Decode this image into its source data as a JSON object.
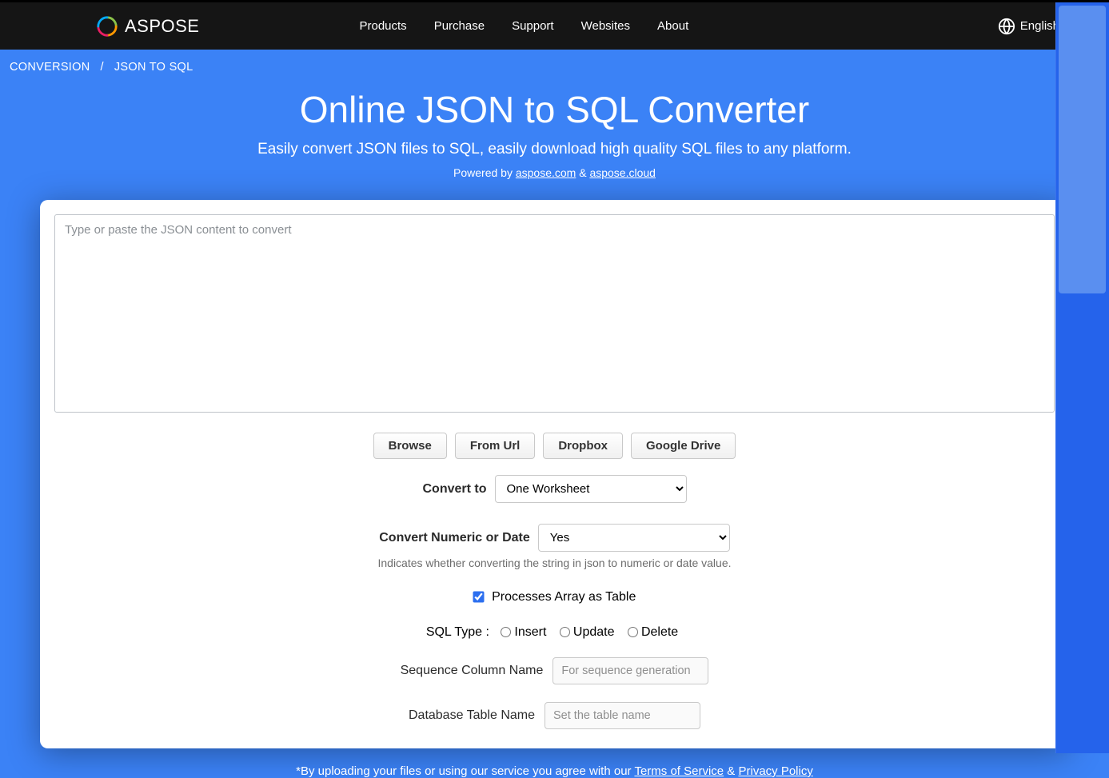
{
  "header": {
    "brand_text": "ASPOSE",
    "nav": [
      "Products",
      "Purchase",
      "Support",
      "Websites",
      "About"
    ],
    "language_label": "English"
  },
  "breadcrumb": {
    "parent": "CONVERSION",
    "sep": "/",
    "current": "JSON TO SQL"
  },
  "hero": {
    "title": "Online JSON to SQL Converter",
    "subtitle": "Easily convert JSON files to SQL, easily download high quality SQL files to any platform.",
    "powered_prefix": "Powered by ",
    "powered_link1": "aspose.com",
    "powered_amp": " & ",
    "powered_link2": "aspose.cloud"
  },
  "form": {
    "textarea_placeholder": "Type or paste the JSON content to convert",
    "buttons": {
      "browse": "Browse",
      "from_url": "From Url",
      "dropbox": "Dropbox",
      "gdrive": "Google Drive"
    },
    "convert_to_label": "Convert to",
    "convert_to_value": "One Worksheet",
    "convert_num_label": "Convert Numeric or Date",
    "convert_num_value": "Yes",
    "convert_num_hint": "Indicates whether converting the string in json to numeric or date value.",
    "process_array_label": "Processes Array as Table",
    "sql_type_label": "SQL Type : ",
    "sql_types": {
      "insert": "Insert",
      "update": "Update",
      "delete": "Delete"
    },
    "seq_label": "Sequence Column Name",
    "seq_placeholder": "For sequence generation",
    "table_label": "Database Table Name",
    "table_placeholder": "Set the table name"
  },
  "footer": {
    "prefix": "*By uploading your files or using our service you agree with our ",
    "tos": "Terms of Service",
    "amp": " & ",
    "privacy": "Privacy Policy"
  }
}
